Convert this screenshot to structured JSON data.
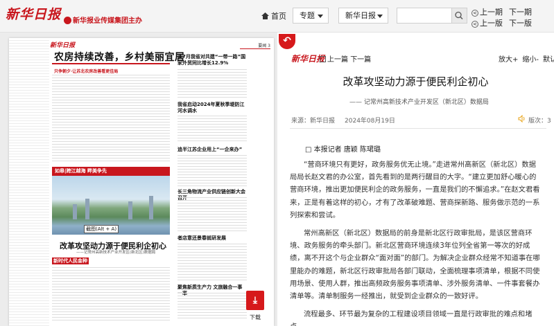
{
  "header": {
    "logo_text": "新华日报",
    "logo_subtitle": "新华报业传媒集团主办",
    "home_label": "首页",
    "topic_dropdown": "专题",
    "paper_dropdown": "新华日报",
    "search_value": "",
    "prev_page": "上一期",
    "next_page": "下一期",
    "prev_edition": "上一版",
    "next_edition": "下一版"
  },
  "newspaper": {
    "logo": "新华日报",
    "page_label": "要闻 3",
    "headline_top": "农房持续改善，乡村美丽宜居",
    "top_sub": "只争朝夕·让苏北农房改善看更佳局",
    "col_titles": [
      "前7月我省对共建“一带一路”国家外贸同比增长12.9%",
      "我省启动2024年夏秋季堤防江河水调水",
      "追半江苏企业用上“一企来办”",
      "长三角物流产业供应链创新大会召开",
      "者店意还景春就研发展",
      "聚焦新质生产力 文旅融合一事一率"
    ],
    "banner": "如皋|跨江越海 畔美争先",
    "clip_label": "截图(Alt + A)",
    "headline_main": "改革攻坚动力源于便民利企初心",
    "sub_main": "——记常州高新技术产业开发区(新北区)数据局",
    "red_tag": "新时代人民金种",
    "download_label": "下载"
  },
  "article": {
    "logo": "新华日报",
    "prev": "上一篇",
    "next": "下一篇",
    "zoom_in": "放大+",
    "zoom_out": "缩小-",
    "default": "默认",
    "title": "改革攻坚动力源于便民利企初心",
    "subtitle": "—— 记常州高新技术产业开发区（新北区）数据局",
    "source": "来源：新华日报",
    "date": "2024年08月19日",
    "edition": "版次：3",
    "author": "□ 本报记者 唐颖 陈珺璐",
    "paragraphs": [
      "“营商环境只有更好，政务服务优无止境。”走进常州高新区（新北区）数据局局长赵文君的办公室，首先看到的是两行醒目的大字。“建立更加舒心暖心的营商环境，推出更加便民利企的政务服务，一直是我们的不懈追求。”在赵文君看来，正是有着这样的初心，才有了改革破难题、营商探新路、服务做示范的一系列探索和尝试。",
      "常州高新区（新北区）数据局的前身是新北区行政审批局，是该区营商环境、政务服务的牵头部门。新北区营商环境连续3年位列全省第一等次的好成绩，离不开这个与企业群众“面对面”的部门。为解决企业群众经常不知道事在哪里能办的难题，新北区行政审批局各部门联动，全面梳理事项清单，根据不同使用场景、使用人群，推出高频政务服务事项清单、涉外服务清单、一件事套餐办清单等。清单制服务一经推出，就受到企业群众的一致好评。",
      "流程最多、环节最为复杂的工程建设项目领域一直是行政审批的难点和堵点。"
    ]
  }
}
